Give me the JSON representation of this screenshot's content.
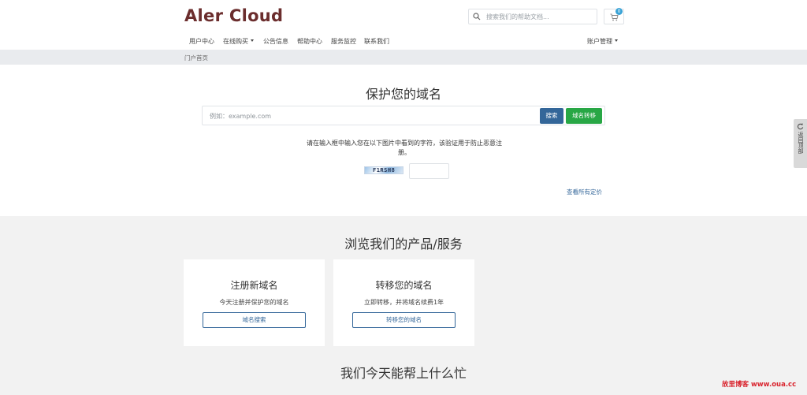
{
  "header": {
    "logo_text": "Aler Cloud",
    "search_placeholder": "搜索我们的帮助文档...",
    "cart_count": "0"
  },
  "nav": {
    "items": [
      {
        "label": "用户中心",
        "dropdown": false
      },
      {
        "label": "在线购买",
        "dropdown": true
      },
      {
        "label": "公告信息",
        "dropdown": false
      },
      {
        "label": "帮助中心",
        "dropdown": false
      },
      {
        "label": "服务监控",
        "dropdown": false
      },
      {
        "label": "联系我们",
        "dropdown": false
      }
    ],
    "account_label": "账户管理"
  },
  "breadcrumb": {
    "home": "门户首页"
  },
  "hero": {
    "title": "保护您的域名",
    "domain_placeholder": "例如：example.com",
    "search_button": "搜索",
    "transfer_button": "域名转移",
    "captcha_instruction": "请在输入框中输入您在以下图片中看到的字符，该验证用于防止恶意注册。",
    "captcha_code": "F1RSH8",
    "pricing_link": "查看所有定价"
  },
  "products": {
    "title": "浏览我们的产品/服务",
    "cards": [
      {
        "title": "注册新域名",
        "desc": "今天注册并保护您的域名",
        "button": "域名搜索"
      },
      {
        "title": "转移您的域名",
        "desc": "立即转移，并将域名续费1年",
        "button": "转移您的域名"
      }
    ],
    "help_title": "我们今天能帮上什么忙"
  },
  "side_tab": {
    "label": "返回顶部"
  },
  "watermark": {
    "text": "故里博客 www.oua.cc"
  },
  "colors": {
    "logo": "#6b2d2d",
    "primary": "#336699",
    "success": "#28a745",
    "badge": "#3aa3d6",
    "section_bg": "#f2f2f2",
    "breadcrumb_bg": "#e9ebee"
  }
}
